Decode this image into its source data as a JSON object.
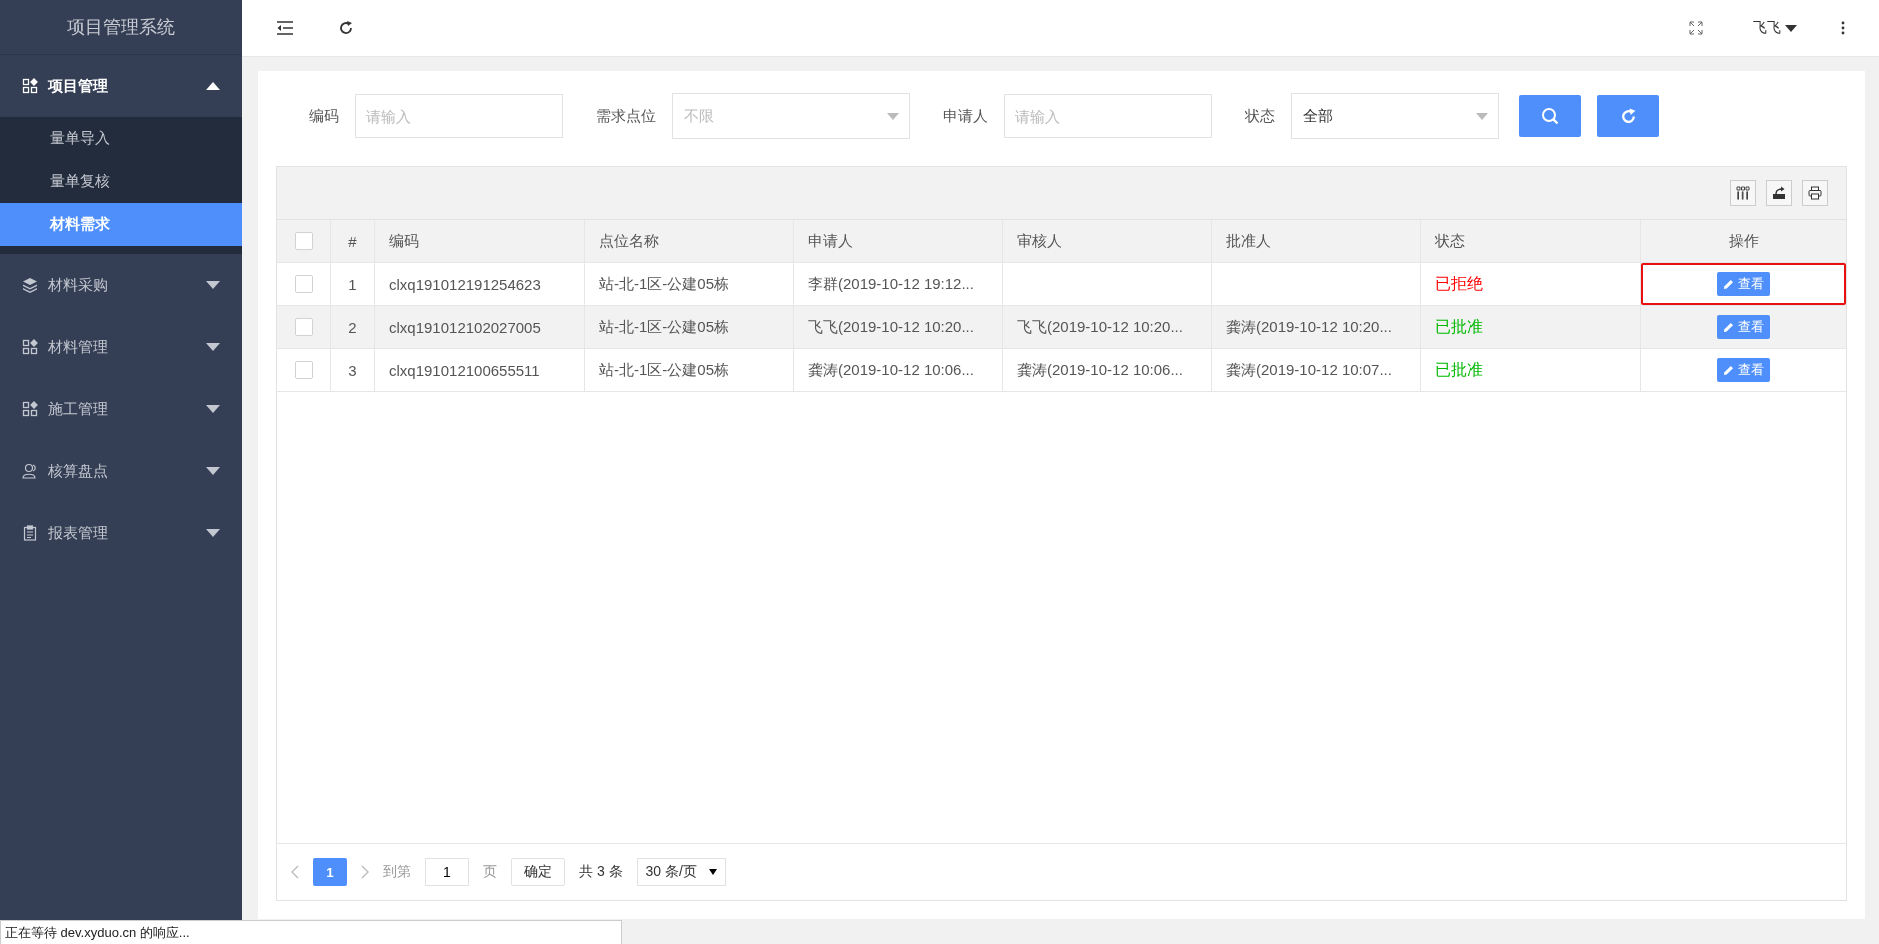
{
  "app_title": "项目管理系统",
  "sidebar": {
    "items": [
      {
        "label": "项目管理",
        "kind": "grid",
        "expanded": true,
        "children": [
          {
            "label": "量单导入",
            "selected": false
          },
          {
            "label": "量单复核",
            "selected": false
          },
          {
            "label": "材料需求",
            "selected": true
          }
        ]
      },
      {
        "label": "材料采购",
        "kind": "layers",
        "expanded": false
      },
      {
        "label": "材料管理",
        "kind": "grid",
        "expanded": false
      },
      {
        "label": "施工管理",
        "kind": "grid",
        "expanded": false
      },
      {
        "label": "核算盘点",
        "kind": "user",
        "expanded": false
      },
      {
        "label": "报表管理",
        "kind": "clipboard",
        "expanded": false
      }
    ]
  },
  "topbar": {
    "user": "飞飞"
  },
  "filters": [
    {
      "kind": "input",
      "label": "编码",
      "placeholder": "请输入"
    },
    {
      "kind": "select",
      "label": "需求点位",
      "placeholder": "不限"
    },
    {
      "kind": "input",
      "label": "申请人",
      "placeholder": "请输入"
    },
    {
      "kind": "select",
      "label": "状态",
      "value": "全部"
    }
  ],
  "table": {
    "all_checked": false,
    "columns": [
      "#",
      "编码",
      "点位名称",
      "申请人",
      "审核人",
      "批准人",
      "状态",
      "操作"
    ],
    "rows": [
      {
        "index": "1",
        "code": "clxq191012191254623",
        "location": "站-北-1区-公建05栋",
        "applicant": "李群(2019-10-12 19:12...",
        "reviewer": "",
        "approver": "",
        "status": "已拒绝",
        "color": "#ff0000",
        "action": "查看",
        "checked": false,
        "highlighted": true
      },
      {
        "index": "2",
        "code": "clxq191012102027005",
        "location": "站-北-1区-公建05栋",
        "applicant": "飞飞(2019-10-12 10:20...",
        "reviewer": "飞飞(2019-10-12 10:20...",
        "approver": "龚涛(2019-10-12 10:20...",
        "status": "已批准",
        "color": "#00b900",
        "action": "查看",
        "checked": false,
        "highlighted": false
      },
      {
        "index": "3",
        "code": "clxq191012100655511",
        "location": "站-北-1区-公建05栋",
        "applicant": "龚涛(2019-10-12 10:06...",
        "reviewer": "龚涛(2019-10-12 10:06...",
        "approver": "龚涛(2019-10-12 10:07...",
        "status": "已批准",
        "color": "#00b900",
        "action": "查看",
        "checked": false,
        "highlighted": false
      }
    ]
  },
  "pagination": {
    "page": "1",
    "goto_label": "到第",
    "goto_value": "1",
    "page_unit": "页",
    "confirm": "确定",
    "total": "共 3 条",
    "page_size": "30 条/页"
  },
  "status_bar": "正在等待 dev.xyduo.cn 的响应..."
}
